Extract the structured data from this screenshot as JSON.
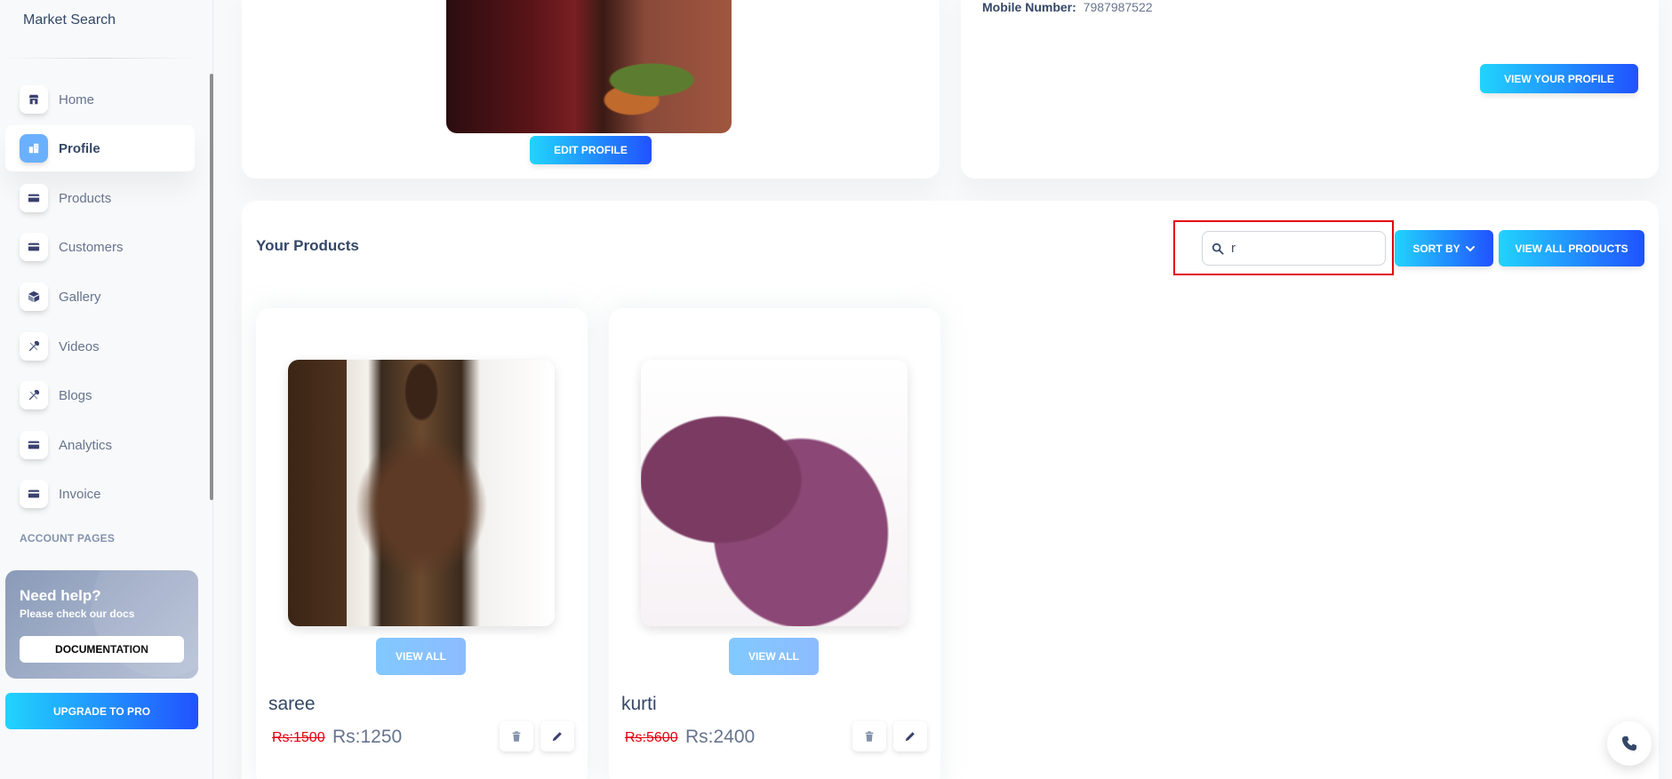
{
  "brand": {
    "title": "Market Search"
  },
  "sidebar": {
    "items": [
      {
        "label": "Home",
        "icon": "shop-icon"
      },
      {
        "label": "Profile",
        "icon": "office-icon",
        "active": true
      },
      {
        "label": "Products",
        "icon": "credit-card-icon"
      },
      {
        "label": "Customers",
        "icon": "credit-card-icon"
      },
      {
        "label": "Gallery",
        "icon": "box-icon"
      },
      {
        "label": "Videos",
        "icon": "tools-icon"
      },
      {
        "label": "Blogs",
        "icon": "tools-icon"
      },
      {
        "label": "Analytics",
        "icon": "credit-card-icon"
      },
      {
        "label": "Invoice",
        "icon": "credit-card-icon"
      }
    ],
    "section_title": "ACCOUNT PAGES",
    "help": {
      "title": "Need help?",
      "subtitle": "Please check our docs",
      "button": "DOCUMENTATION"
    },
    "upgrade_button": "UPGRADE TO PRO"
  },
  "profile_card": {
    "edit_button": "EDIT PROFILE"
  },
  "info_card": {
    "mobile_label": "Mobile Number:",
    "mobile_value": "7987987522",
    "view_profile_button": "VIEW YOUR PROFILE"
  },
  "products": {
    "title": "Your Products",
    "search": {
      "value": "r",
      "placeholder": ""
    },
    "sort_button": "SORT BY",
    "view_all_button": "VIEW ALL PRODUCTS",
    "items": [
      {
        "name": "saree",
        "old_price": "Rs:1500",
        "new_price": "Rs:1250",
        "view_all": "VIEW ALL"
      },
      {
        "name": "kurti",
        "old_price": "Rs:5600",
        "new_price": "Rs:2400",
        "view_all": "VIEW ALL"
      }
    ]
  },
  "colors": {
    "accent_gradient_start": "#21d4fd",
    "accent_gradient_end": "#2152ff",
    "highlight_border": "#e3000f",
    "text_primary": "#344767",
    "text_secondary": "#67748e"
  }
}
